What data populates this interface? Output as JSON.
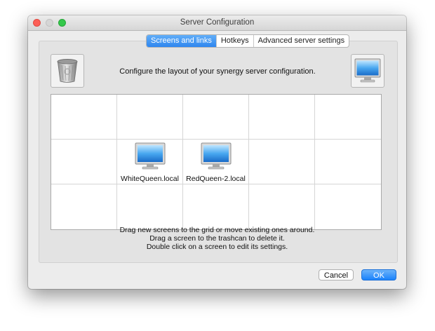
{
  "window": {
    "title": "Server Configuration"
  },
  "tabs": [
    {
      "label": "Screens and links",
      "active": true
    },
    {
      "label": "Hotkeys",
      "active": false
    },
    {
      "label": "Advanced server settings",
      "active": false
    }
  ],
  "header": {
    "description": "Configure the layout of your synergy server configuration."
  },
  "icons": {
    "trash": "trash-icon",
    "new_screen": "monitor-icon"
  },
  "grid": {
    "screens": [
      {
        "row": 1,
        "col": 1,
        "name": "WhiteQueen.local"
      },
      {
        "row": 1,
        "col": 2,
        "name": "RedQueen-2.local"
      }
    ]
  },
  "instructions": [
    "Drag new screens to the grid or move existing ones around.",
    "Drag a screen to the trashcan to delete it.",
    "Double click on a screen to edit its settings."
  ],
  "buttons": {
    "cancel": "Cancel",
    "ok": "OK"
  },
  "colors": {
    "accent": "#2e86ef",
    "close": "#fc5f57",
    "maximize": "#34c84a"
  }
}
